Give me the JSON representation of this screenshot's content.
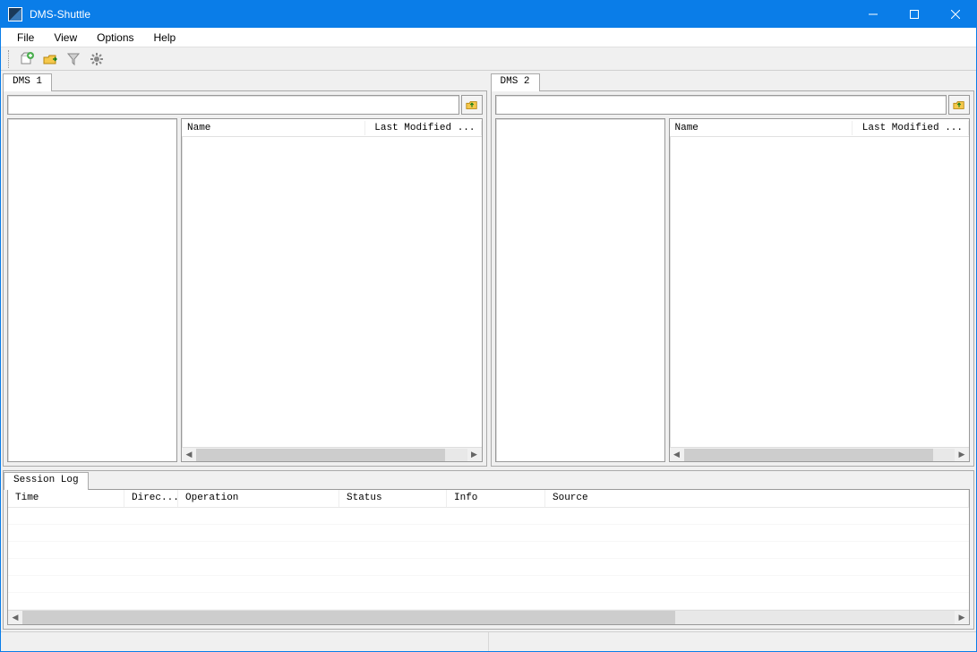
{
  "window": {
    "title": "DMS-Shuttle"
  },
  "menu": {
    "file": "File",
    "view": "View",
    "options": "Options",
    "help": "Help"
  },
  "toolbar": {
    "new_connection": "new-connection",
    "connect": "connect",
    "filter": "filter",
    "settings": "settings"
  },
  "panels": {
    "left": {
      "tab_label": "DMS 1",
      "path_value": "",
      "columns": {
        "name": "Name",
        "modified": "Last Modified ..."
      }
    },
    "right": {
      "tab_label": "DMS 2",
      "path_value": "",
      "columns": {
        "name": "Name",
        "modified": "Last Modified ..."
      }
    }
  },
  "session_log": {
    "tab_label": "Session Log",
    "columns": {
      "time": "Time",
      "direction": "Direc...",
      "operation": "Operation",
      "status": "Status",
      "info": "Info",
      "source": "Source"
    },
    "rows": []
  },
  "statusbar": {
    "left": "",
    "right": ""
  }
}
